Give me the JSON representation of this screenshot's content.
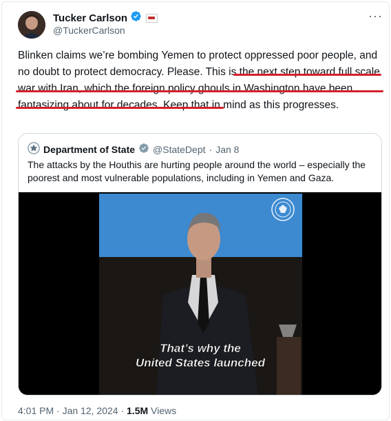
{
  "author": {
    "name": "Tucker Carlson",
    "handle": "@TuckerCarlson"
  },
  "tweet": {
    "text_plain": "Blinken claims we’re bombing Yemen to protect oppressed poor people, and no doubt to protect democracy. Please. ",
    "text_highlight": "This is the next step toward full scale war with Iran, which the foreign policy ghouls in Washington have been fantasizing about for decades.",
    "text_tail": " Keep that in mind as this progresses."
  },
  "quote": {
    "name": "Department of State",
    "handle": "@StateDept",
    "separator": "·",
    "date": "Jan 8",
    "text": "The attacks by the Houthis are hurting people around the world – especially the poorest and most vulnerable populations, including in Yemen and Gaza.",
    "caption_line1": "That’s why the",
    "caption_line2": "United States launched"
  },
  "footer": {
    "time": "4:01 PM",
    "separator": "·",
    "date": "Jan 12, 2024",
    "views_count": "1.5M",
    "views_label": "Views"
  },
  "colors": {
    "verified_blue": "#1d9bf0",
    "verified_gray": "#829aab",
    "underline_red": "#d4202a",
    "video_blue": "#3d8ad1"
  },
  "icons": {
    "verified": "verified-badge-icon",
    "affiliation": "affiliate-badge-icon",
    "more": "more-options-icon",
    "state_seal": "state-department-seal-icon"
  }
}
